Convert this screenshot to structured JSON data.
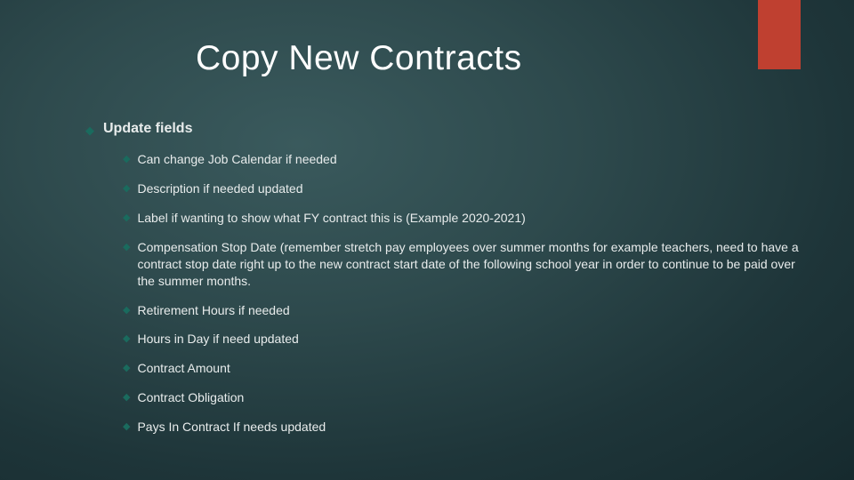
{
  "accent_color": "#bf4030",
  "title": "Copy New Contracts",
  "main_bullet": "◆",
  "main": {
    "label": "Update fields",
    "items": [
      "Can change Job Calendar if needed",
      "Description if needed updated",
      "Label if wanting to show what FY contract this is (Example 2020-2021)",
      "Compensation Stop Date (remember stretch pay employees over summer months for example teachers, need to have a contract stop date right up to the new contract start date of the following school year in order to continue to be paid over the summer months.",
      "Retirement Hours if needed",
      "Hours in Day if need updated",
      "Contract Amount",
      "Contract Obligation",
      "Pays In Contract If needs updated"
    ]
  }
}
